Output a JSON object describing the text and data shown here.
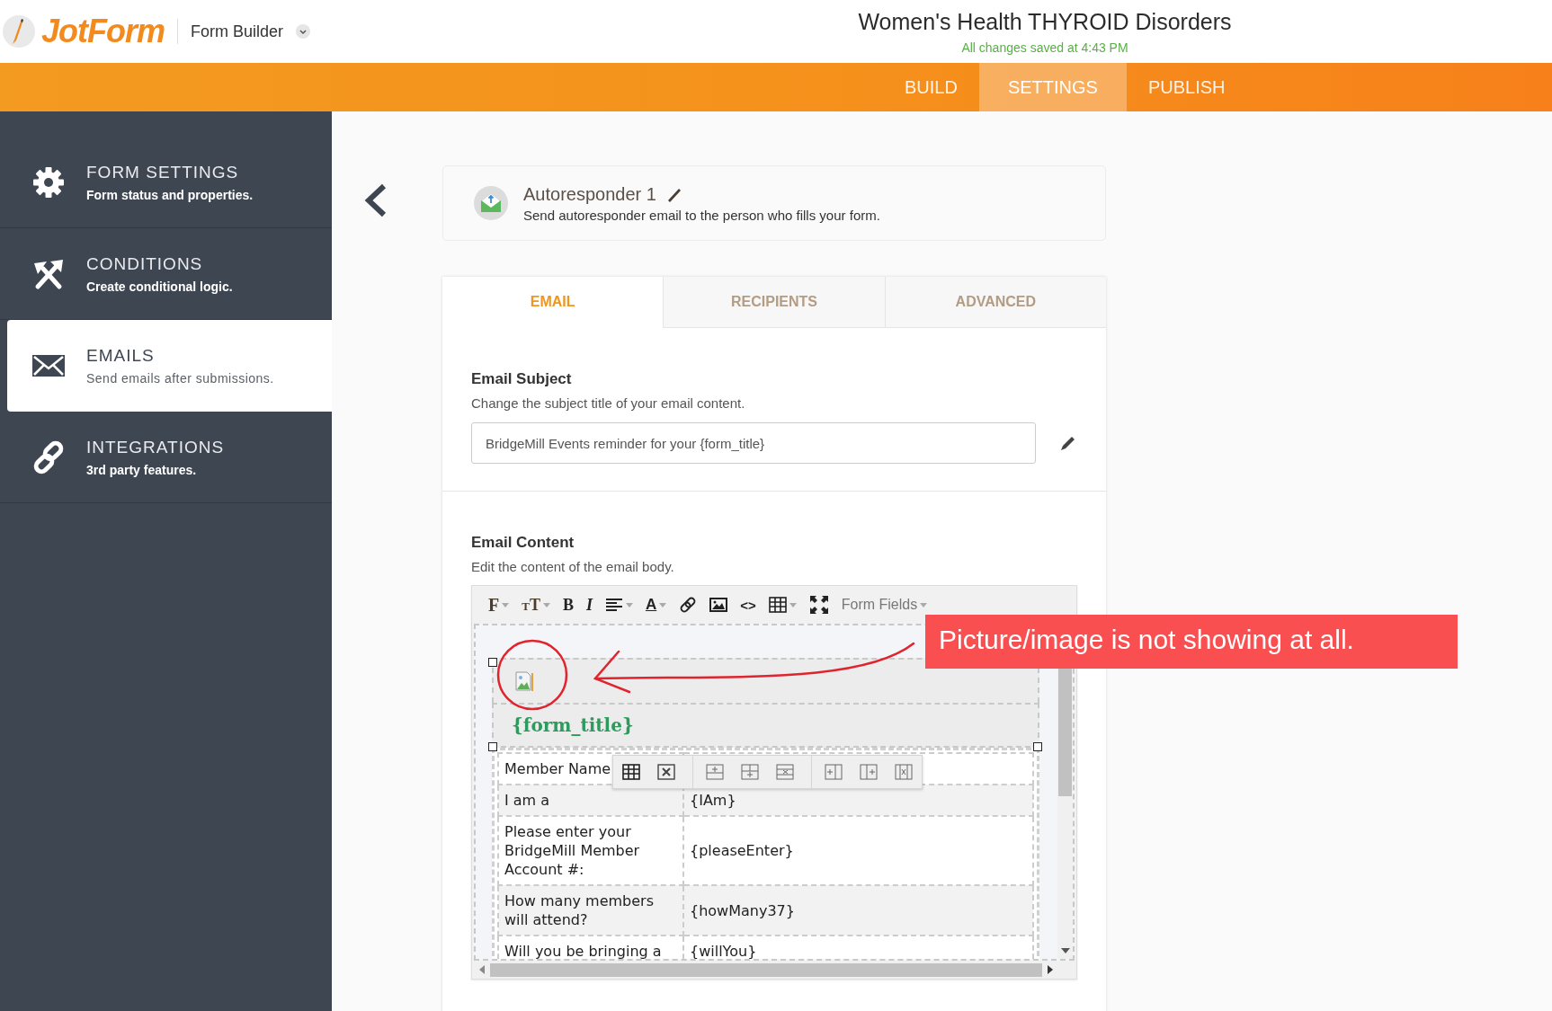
{
  "header": {
    "logo": "JotForm",
    "app_menu": "Form Builder",
    "form_title": "Women's Health THYROID Disorders",
    "save_status": "All changes saved at 4:43 PM"
  },
  "nav_tabs": [
    {
      "label": "BUILD",
      "selected": false
    },
    {
      "label": "SETTINGS",
      "selected": true
    },
    {
      "label": "PUBLISH",
      "selected": false
    }
  ],
  "sidebar": {
    "items": [
      {
        "title": "FORM SETTINGS",
        "subtitle": "Form status and properties.",
        "selected": false
      },
      {
        "title": "CONDITIONS",
        "subtitle": "Create conditional logic.",
        "selected": false
      },
      {
        "title": "EMAILS",
        "subtitle": "Send emails after submissions.",
        "selected": true
      },
      {
        "title": "INTEGRATIONS",
        "subtitle": "3rd party features.",
        "selected": false
      }
    ]
  },
  "autoresponder": {
    "name": "Autoresponder 1",
    "description": "Send autoresponder email to the person who fills your form."
  },
  "tabs": [
    {
      "label": "EMAIL",
      "selected": true
    },
    {
      "label": "RECIPIENTS",
      "selected": false
    },
    {
      "label": "ADVANCED",
      "selected": false
    }
  ],
  "email_subject": {
    "label": "Email Subject",
    "description": "Change the subject title of your email content.",
    "value": "BridgeMill Events reminder for your {form_title}"
  },
  "email_content": {
    "label": "Email Content",
    "description": "Edit the content of the email body.",
    "toolbar": [
      {
        "kind": "text",
        "label": "F",
        "caret": true
      },
      {
        "kind": "text",
        "label": "TT",
        "caret": true
      },
      {
        "kind": "text",
        "label": "B",
        "caret": false
      },
      {
        "kind": "text",
        "label": "I",
        "caret": false
      },
      {
        "kind": "icon",
        "caret": true
      },
      {
        "kind": "text",
        "label": "A",
        "caret": true
      },
      {
        "kind": "icon",
        "caret": false
      },
      {
        "kind": "icon",
        "caret": false
      },
      {
        "kind": "text",
        "label": "<>",
        "caret": false
      },
      {
        "kind": "icon",
        "caret": true
      },
      {
        "kind": "icon",
        "caret": false
      },
      {
        "kind": "text",
        "label": "Form Fields",
        "caret": true
      }
    ],
    "title_tag": "{form_title}",
    "rows": [
      [
        "Member Name",
        ""
      ],
      [
        "I am a",
        "{IAm}"
      ],
      [
        "Please enter your BridgeMill Member Account #:",
        "{pleaseEnter}"
      ],
      [
        "How many members will attend?",
        "{howMany37}"
      ],
      [
        "Will you be bringing a",
        "{willYou}"
      ]
    ]
  },
  "annotation": {
    "text": "Picture/image is not showing at all."
  }
}
